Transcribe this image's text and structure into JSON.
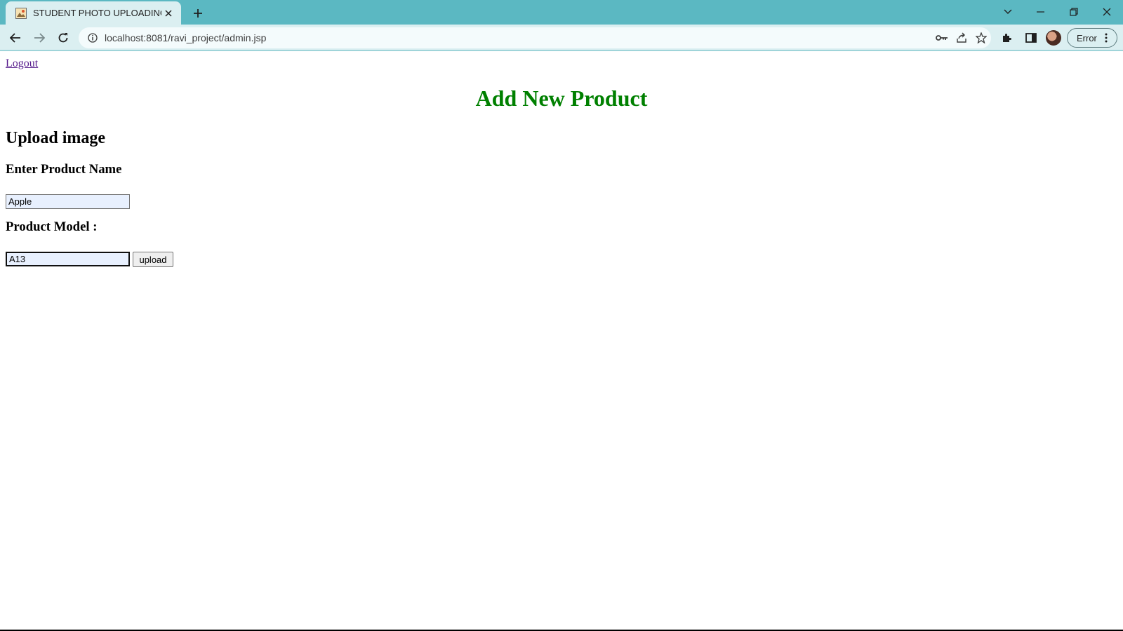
{
  "browser": {
    "tab": {
      "title": "STUDENT PHOTO UPLOADING",
      "favicon": "image-icon"
    },
    "url": "localhost:8081/ravi_project/admin.jsp",
    "profile_status": "Error"
  },
  "page": {
    "logout_link": "Logout",
    "title": "Add New Product",
    "upload_heading": "Upload image",
    "product_name_label": "Enter Product Name",
    "product_name_value": "Apple",
    "product_model_label": "Product Model :",
    "product_model_value": "A13",
    "upload_button": "upload"
  },
  "colors": {
    "title_green": "#008000",
    "chrome_teal": "#5bb8c2",
    "toolbar_bg": "#dbeff1",
    "link_visited": "#551a8b",
    "autofill_bg": "#e8f0fe"
  }
}
